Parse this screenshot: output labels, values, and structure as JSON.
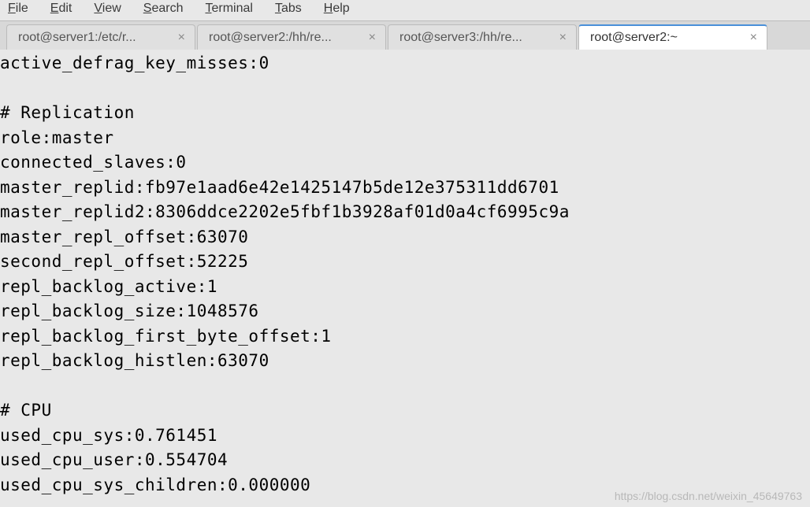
{
  "menu": {
    "file": "File",
    "edit": "Edit",
    "view": "View",
    "search": "Search",
    "terminal": "Terminal",
    "tabs": "Tabs",
    "help": "Help"
  },
  "tabs": [
    {
      "label": "root@server1:/etc/r..."
    },
    {
      "label": "root@server2:/hh/re..."
    },
    {
      "label": "root@server3:/hh/re..."
    },
    {
      "label": "root@server2:~"
    }
  ],
  "terminal": {
    "lines": [
      "active_defrag_key_misses:0",
      "",
      "# Replication",
      "role:master",
      "connected_slaves:0",
      "master_replid:fb97e1aad6e42e1425147b5de12e375311dd6701",
      "master_replid2:8306ddce2202e5fbf1b3928af01d0a4cf6995c9a",
      "master_repl_offset:63070",
      "second_repl_offset:52225",
      "repl_backlog_active:1",
      "repl_backlog_size:1048576",
      "repl_backlog_first_byte_offset:1",
      "repl_backlog_histlen:63070",
      "",
      "# CPU",
      "used_cpu_sys:0.761451",
      "used_cpu_user:0.554704",
      "used_cpu_sys_children:0.000000"
    ]
  },
  "watermark": "https://blog.csdn.net/weixin_45649763"
}
